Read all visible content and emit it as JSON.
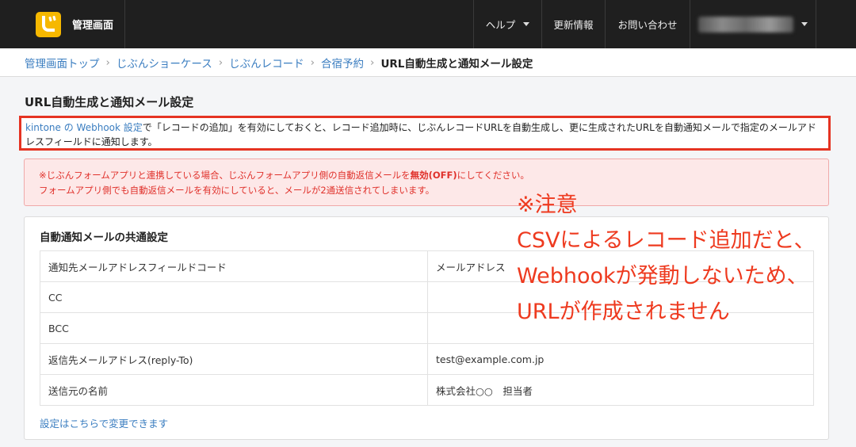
{
  "header": {
    "app_title": "管理画面",
    "nav": {
      "help": "ヘルプ",
      "updates": "更新情報",
      "contact": "お問い合わせ"
    }
  },
  "breadcrumb": {
    "items": [
      "管理画面トップ",
      "じぶんショーケース",
      "じぶんレコード",
      "合宿予約"
    ],
    "current": "URL自動生成と通知メール設定"
  },
  "page": {
    "title": "URL自動生成と通知メール設定",
    "description_link": "kintone の Webhook 設定",
    "description_text": "で「レコードの追加」を有効にしておくと、レコード追加時に、じぶんレコードURLを自動生成し、更に生成されたURLを自動通知メールで指定のメールアドレスフィールドに通知します。"
  },
  "warning": {
    "line1_prefix": "※じぶんフォームアプリと連携している場合、じぶんフォームアプリ側の自動返信メールを",
    "line1_bold": "無効(OFF)",
    "line1_suffix": "にしてください。",
    "line2": "フォームアプリ側でも自動返信メールを有効にしていると、メールが2通送信されてしまいます。"
  },
  "mail_settings": {
    "title": "自動通知メールの共通設定",
    "rows": [
      {
        "key": "通知先メールアドレスフィールドコード",
        "value": "メールアドレス"
      },
      {
        "key": "CC",
        "value": ""
      },
      {
        "key": "BCC",
        "value": ""
      },
      {
        "key": "返信先メールアドレス(reply-To)",
        "value": "test@example.com.jp"
      },
      {
        "key": "送信元の名前",
        "value": "株式会社○○　担当者"
      }
    ],
    "change_link": "設定はこちらで変更できます"
  },
  "annotation": {
    "line1": "※注意",
    "line2": "CSVによるレコード追加だと、",
    "line3": "Webhookが発動しないため、",
    "line4": "URLが作成されません"
  },
  "colors": {
    "header_bg": "#1f1f1f",
    "link": "#3a7dc0",
    "warning_text": "#e0312b",
    "annotation": "#ee3a1f",
    "logo": "#f6b800"
  }
}
